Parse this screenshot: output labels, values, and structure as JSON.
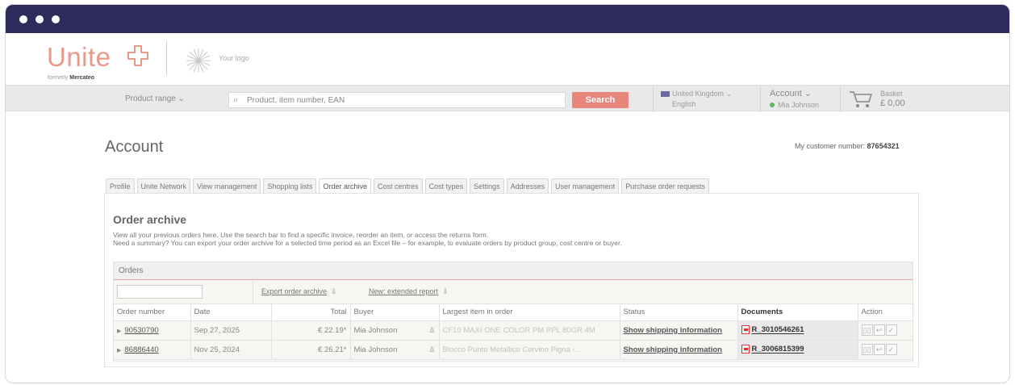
{
  "header": {
    "brand": "Unite",
    "formerly_prefix": "formerly",
    "formerly_name": "Mercateo",
    "your_logo": "Your logo"
  },
  "navbar": {
    "product_range": "Product range ⌄",
    "search_placeholder": "Product, item number, EAN",
    "search_button": "Search",
    "country": "United Kingdom",
    "language": "English",
    "account_label": "Account ⌄",
    "account_user": "Mia Johnson",
    "basket_label": "Basket",
    "basket_amount": "£ 0,00"
  },
  "page": {
    "title": "Account",
    "customer_number_label": "My customer number:",
    "customer_number": "87654321"
  },
  "tabs": [
    {
      "label": "Profile"
    },
    {
      "label": "Unite Network"
    },
    {
      "label": "View management"
    },
    {
      "label": "Shopping lists"
    },
    {
      "label": "Order archive"
    },
    {
      "label": "Cost centres"
    },
    {
      "label": "Cost types"
    },
    {
      "label": "Settings"
    },
    {
      "label": "Addresses"
    },
    {
      "label": "User management"
    },
    {
      "label": "Purchase order requests"
    }
  ],
  "active_tab": "Order archive",
  "archive": {
    "title": "Order archive",
    "desc_line1": "View all your previous orders here. Use the search bar to find a specific invoice, reorder an item, or access the returns form.",
    "desc_line2": "Need a summary? You can export your order archive for a selected time period as an Excel file – for example, to evaluate orders by product group, cost centre or buyer.",
    "orders_label": "Orders",
    "export_link": "Export order archive",
    "new_report_link": "New: extended report"
  },
  "table": {
    "columns": [
      "Order number",
      "Date",
      "Total",
      "Buyer",
      "Largest item in order",
      "Status",
      "Documents",
      "Action"
    ],
    "rows": [
      {
        "order": "90530790",
        "date": "Sep 27, 2025",
        "total": "€ 22.19*",
        "buyer": "Mia Johnson",
        "item": "CF10 MAXI ONE COLOR PM PPL 80GR 4M",
        "status": "Show shipping information",
        "document": "R_3010546261"
      },
      {
        "order": "86886440",
        "date": "Nov 25, 2024",
        "total": "€ 26.21*",
        "buyer": "Mia Johnson",
        "item": "Blocco Punto Metallico Cervino Pigna -...",
        "status": "Show shipping information",
        "document": "R_3006815399"
      }
    ]
  },
  "colors": {
    "titlebar": "#2e2c5c",
    "brand": "#e89a8a",
    "search_button": "#e8867c"
  }
}
